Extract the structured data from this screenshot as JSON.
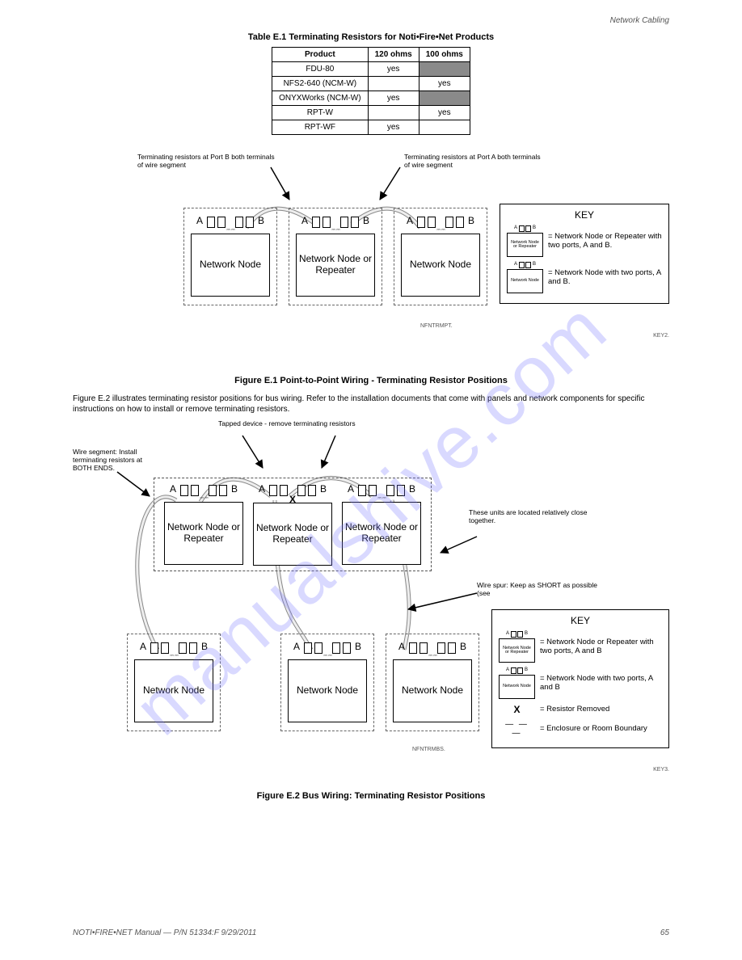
{
  "header_right": "Network Cabling",
  "table": {
    "title": "Table E.1 Terminating Resistors for Noti•Fire•Net Products",
    "cols": [
      "Product",
      "120 ohms",
      "100 ohms"
    ],
    "rows": [
      {
        "c0": "FDU-80",
        "c1": "yes",
        "c2": ""
      },
      {
        "c0": "NFS2-640 (NCM-W)",
        "c1": "",
        "c2": "yes"
      },
      {
        "c0": "ONYXWorks (NCM-W)",
        "c1": "yes",
        "c2": ""
      },
      {
        "c0": "RPT-W",
        "c1": "",
        "c2": "yes"
      },
      {
        "c0": "RPT-WF",
        "c1": "yes",
        "c2": ""
      }
    ]
  },
  "fig1": {
    "title": "Figure E.1 Point-to-Point Wiring - Terminating Resistor Positions",
    "arrowA": "Terminating resistors at Port B both terminals of wire segment",
    "arrowB": "Terminating resistors at Port A both terminals of wire segment",
    "node_left": "Network Node",
    "node_mid": "Network Node or Repeater",
    "node_right": "Network Node",
    "cite": "NFNTRMPT.",
    "key": {
      "title": "KEY",
      "entry1_label": "Network Node or Repeater",
      "entry1_txt": "= Network Node or Repeater with two ports, A and B.",
      "entry2_label": "Network Node",
      "entry2_txt": "= Network Node with two ports, A and B.",
      "cite": "KEY2."
    }
  },
  "mid_para": "Figure E.2 illustrates terminating resistor positions for bus wiring. Refer to the installation documents that come with panels and network components for specific instructions on how to install or remove terminating resistors.",
  "fig2": {
    "title": "Figure E.2 Bus Wiring: Terminating Resistor Positions",
    "lbl_wire_seg": "Wire segment: Install terminating resistors at BOTH ENDS.",
    "lbl_close": "These units are located relatively close together.",
    "lbl_spur": "Wire spur: Keep as SHORT as possible (see",
    "lbl_tapped": "Tapped device - remove terminating resistors",
    "node_nr": "Network Node or Repeater",
    "node_nn": "Network Node",
    "cite": "NFNTRMBS.",
    "key": {
      "title": "KEY",
      "entry1_label": "Network Node or Repeater",
      "entry1_txt": "= Network Node or Repeater with two ports, A and B",
      "entry2_label": "Network Node",
      "entry2_txt": "= Network Node with two ports, A and B",
      "entry3_txt": "= Resistor Removed",
      "entry4_txt": "= Enclosure or Room Boundary",
      "cite": "KEY3."
    }
  },
  "ports": {
    "a": "A",
    "b": "B"
  },
  "x_sym": "X",
  "dash_sym": "— — —",
  "footer_left": "NOTI•FIRE•NET Manual — P/N 51334:F  9/29/2011",
  "footer_right": "65"
}
